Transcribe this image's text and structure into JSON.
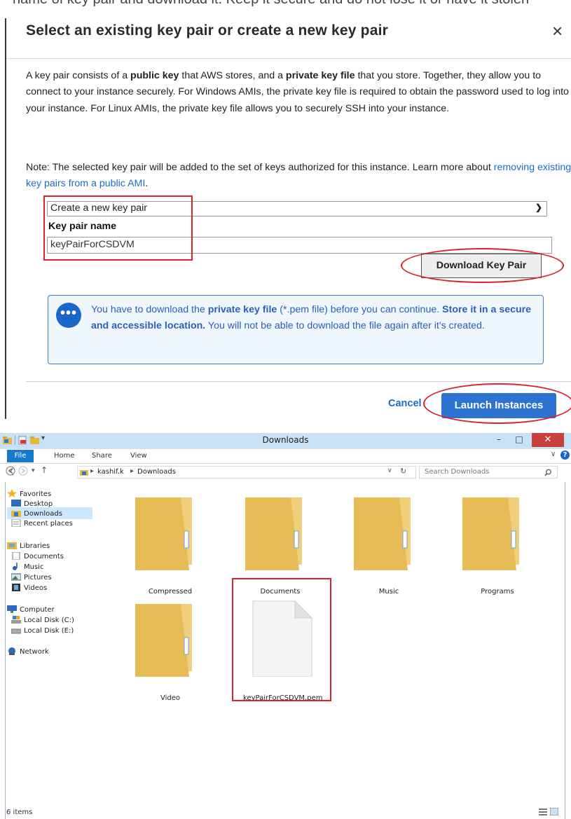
{
  "top_cut_text": "name of key pair and download it. Keep it secure and do not lose it or have it stolen",
  "modal": {
    "title": "Select an existing key pair or create a new key pair",
    "close_glyph": "×",
    "intro": {
      "t1": "A key pair consists of a ",
      "b1": "public key",
      "t2": " that AWS stores, and a ",
      "b2": "private key file",
      "t3": " that you store. Together, they allow you to connect to your instance securely. For Windows AMIs, the private key file is required to obtain the password used to log into your instance. For Linux AMIs, the private key file allows you to securely SSH into your instance."
    },
    "note": {
      "text": "Note: The selected key pair will be added to the set of keys authorized for this instance. Learn more about ",
      "link": "removing existing key pairs from a public AMI",
      "tail": "."
    },
    "key_pair_select": {
      "value": "Create a new key pair"
    },
    "key_pair_name_label": "Key pair name",
    "key_pair_name_value": "keyPairForCSDVM",
    "download_button": "Download Key Pair",
    "info": {
      "t1": "You have to download the ",
      "b1": "private key file",
      "t2": " (*.pem file) before you can continue. ",
      "b2": "Store it in a secure and accessible location.",
      "t3": " You will not be able to download the file again after it's created."
    },
    "cancel_label": "Cancel",
    "launch_button": "Launch Instances",
    "colors": {
      "accent": "#1a6dc6",
      "annotation_red": "#d9232e",
      "info_bg": "#eff7fd"
    }
  },
  "explorer": {
    "title": "Downloads",
    "ribbon_tabs": [
      "File",
      "Home",
      "Share",
      "View"
    ],
    "breadcrumb": [
      "kashif.k",
      "Downloads"
    ],
    "search_placeholder": "Search Downloads",
    "nav": {
      "favorites": "Favorites",
      "desktop": "Desktop",
      "downloads": "Downloads",
      "recent": "Recent places",
      "libraries": "Libraries",
      "documents": "Documents",
      "music": "Music",
      "pictures": "Pictures",
      "videos": "Videos",
      "computer": "Computer",
      "disk_c": "Local Disk (C:)",
      "disk_e": "Local Disk (E:)",
      "network": "Network"
    },
    "items": [
      {
        "name": "Compressed",
        "icon": "folder-icon"
      },
      {
        "name": "Documents",
        "icon": "folder-icon"
      },
      {
        "name": "Music",
        "icon": "folder-icon"
      },
      {
        "name": "Programs",
        "icon": "folder-icon"
      },
      {
        "name": "Video",
        "icon": "folder-icon"
      },
      {
        "name": "keyPairForCSDVM.pem",
        "icon": "file-icon"
      }
    ],
    "status": "6 items",
    "colors": {
      "title_bar": "#c7e1f7",
      "file_tab": "#1979ca",
      "close_button": "#c9413e"
    }
  }
}
